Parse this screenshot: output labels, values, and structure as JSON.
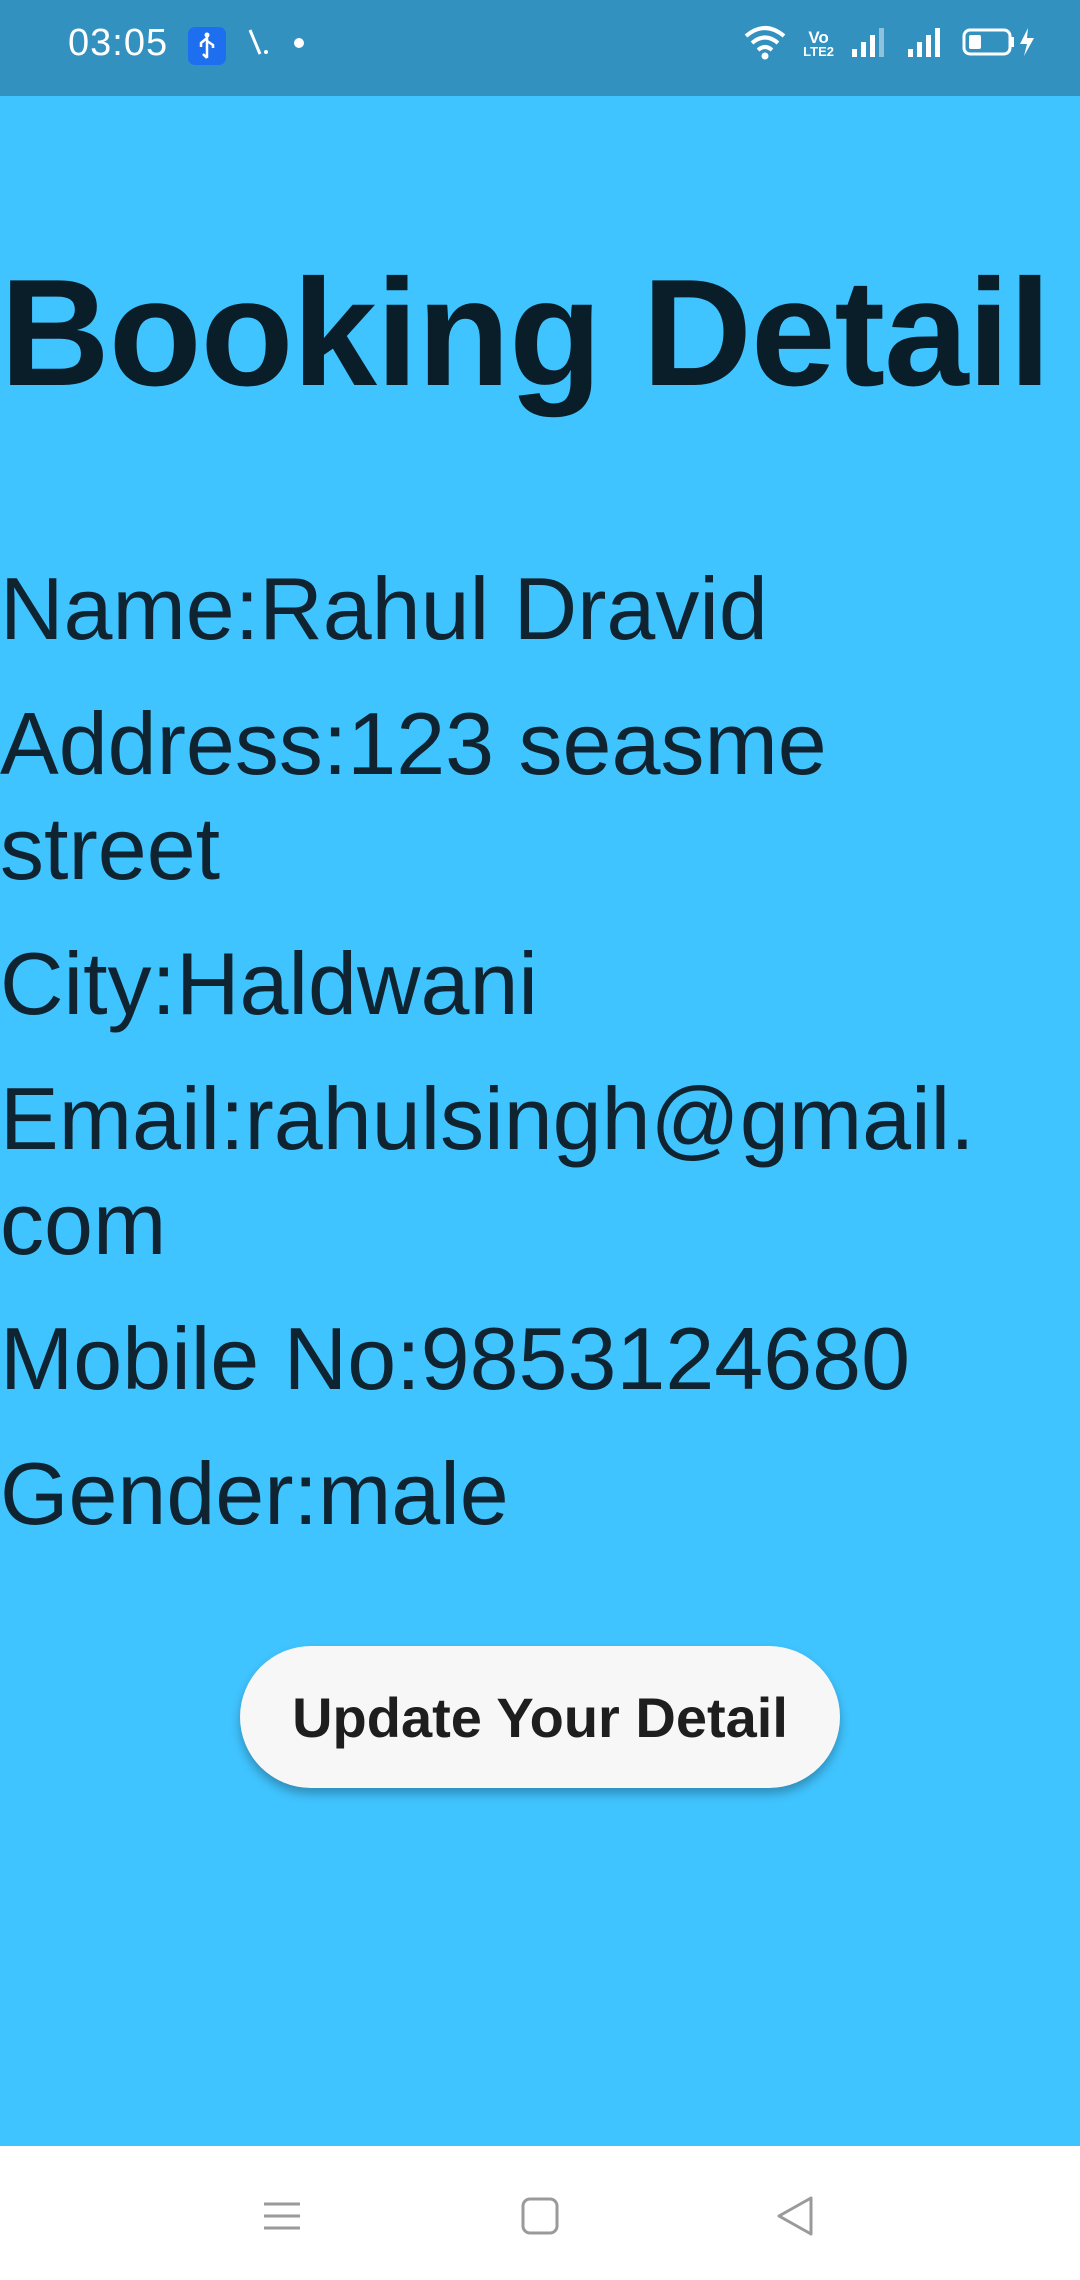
{
  "status_bar": {
    "time": "03:05",
    "left_icons": [
      "usb-icon",
      "missed-call-icon",
      "dot-icon"
    ],
    "right_icons": [
      "wifi-icon",
      "volte-icon",
      "signal-icon",
      "signal-icon",
      "battery-charging-icon"
    ],
    "volte_text_top": "Vo",
    "volte_text_bottom": "LTE2"
  },
  "page": {
    "title": "Booking Detail",
    "details": [
      {
        "label": "Name:",
        "value": "Rahul Dravid"
      },
      {
        "label": "Address:",
        "value": "123 seasme street"
      },
      {
        "label": "City:",
        "value": "Haldwani"
      },
      {
        "label": "Email:",
        "value": "rahulsingh@gmail.com"
      },
      {
        "label": "Mobile No:",
        "value": "9853124680"
      },
      {
        "label": "Gender:",
        "value": "male"
      }
    ],
    "update_button_label": "Update Your Detail"
  },
  "nav_bar": {
    "icons": [
      "menu-icon",
      "home-icon",
      "back-icon"
    ]
  },
  "colors": {
    "background": "#40C4FF",
    "status_bar": "#3391C0",
    "button": "#F7F7F7"
  }
}
